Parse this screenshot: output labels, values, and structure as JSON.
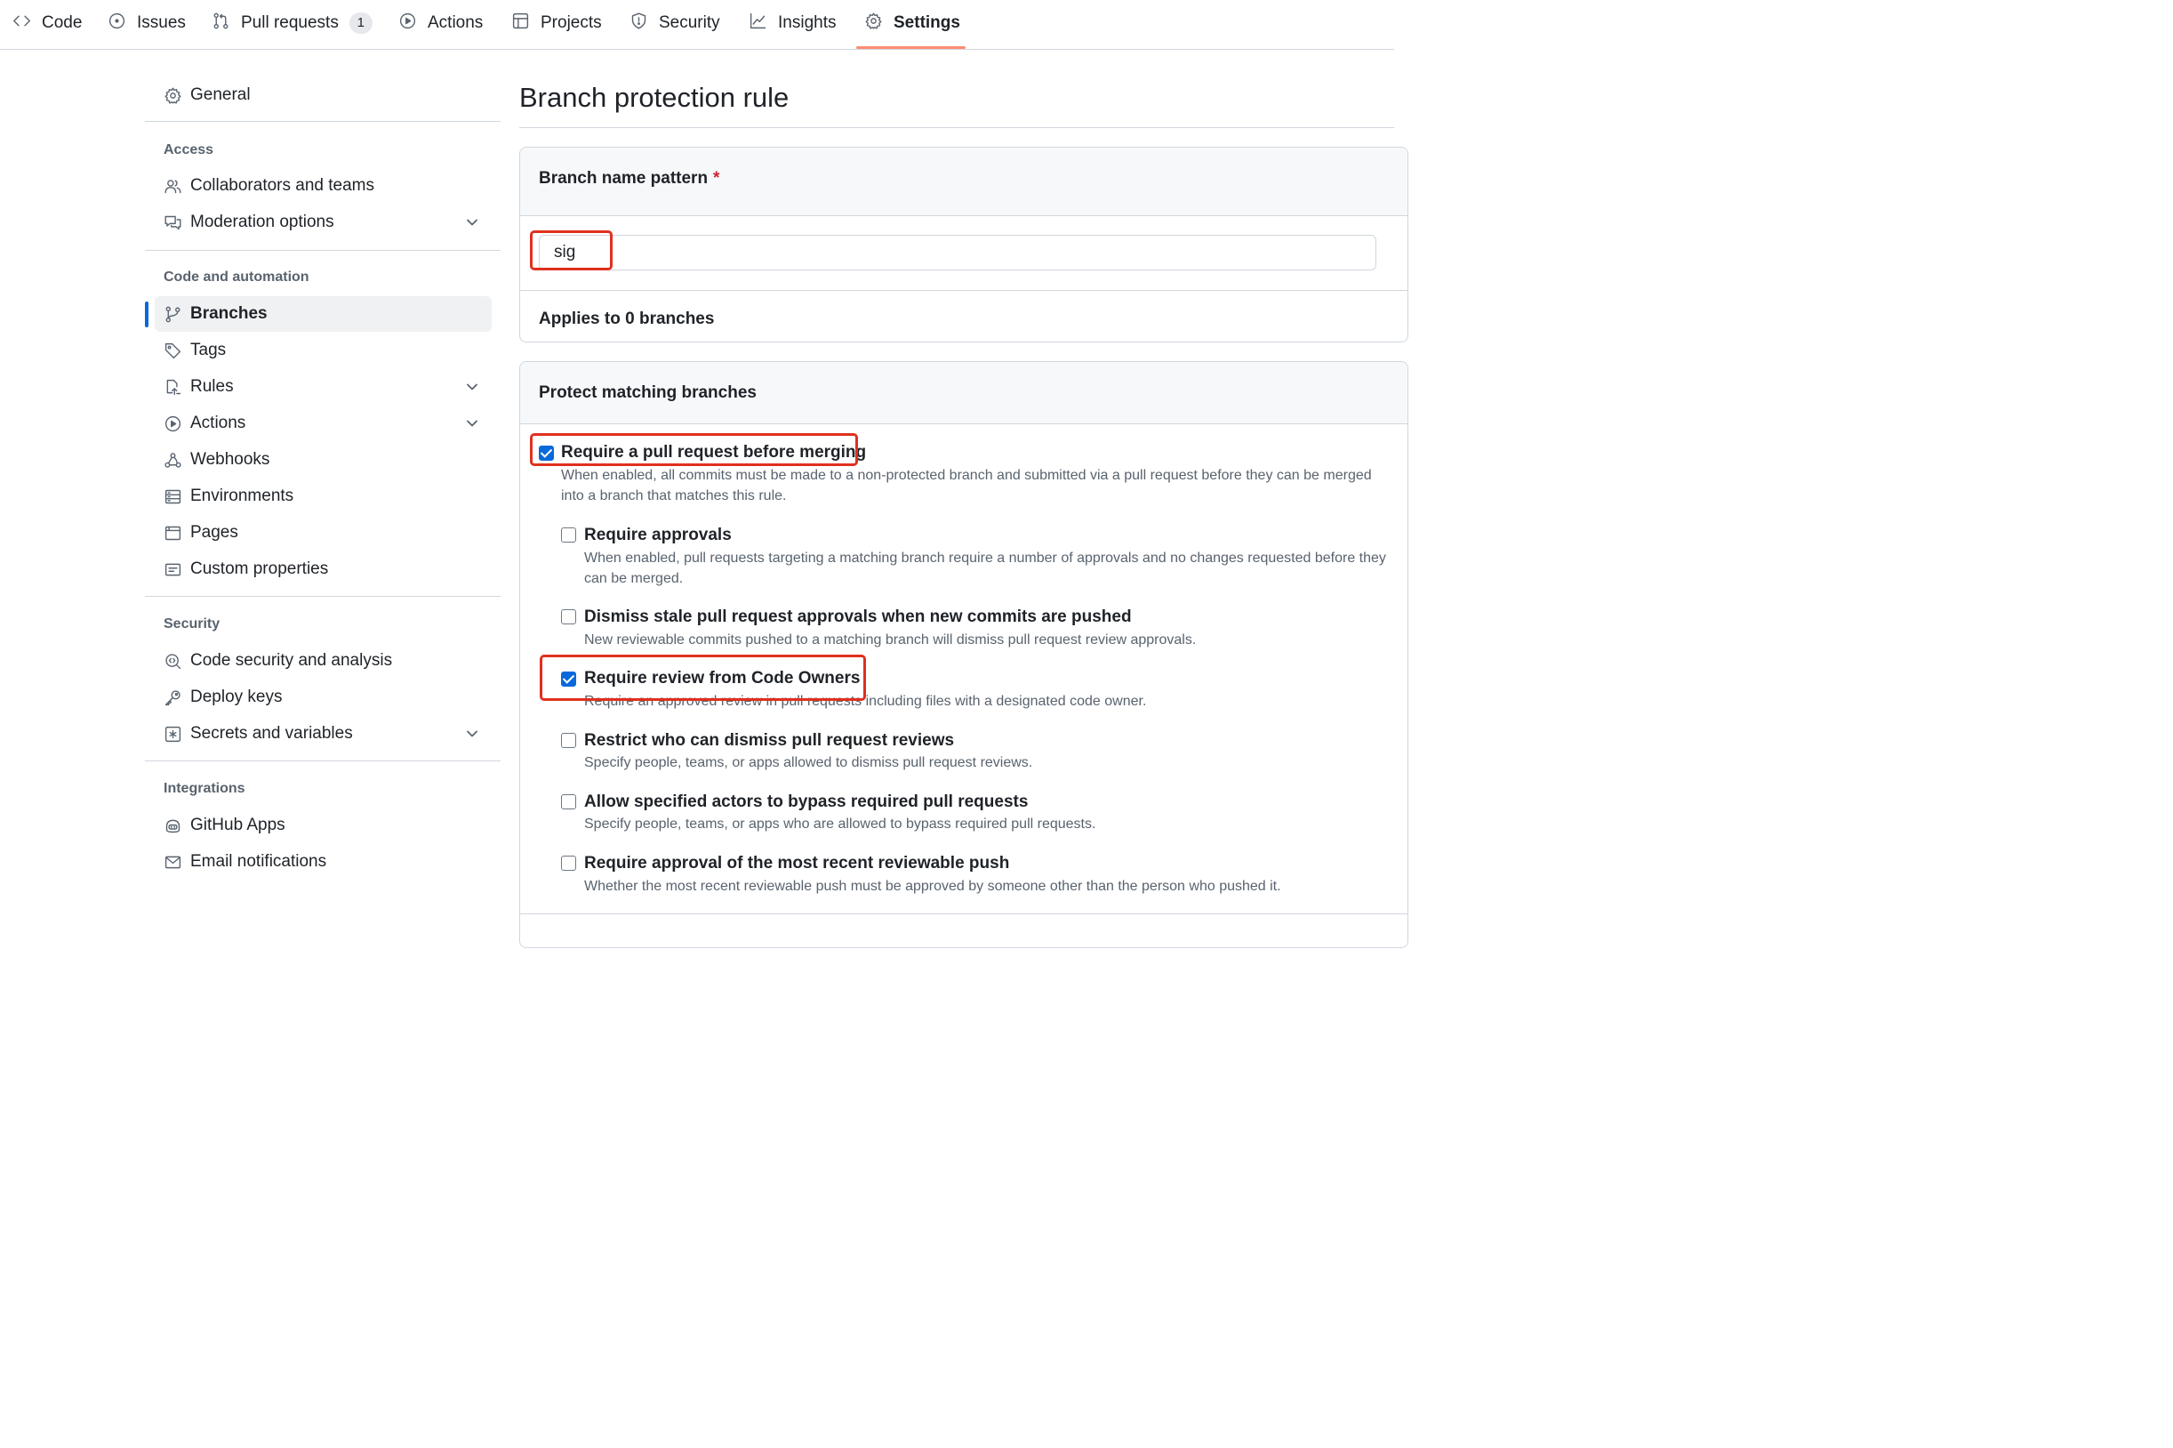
{
  "nav": {
    "tabs": [
      {
        "label": "Code",
        "icon": "code-icon"
      },
      {
        "label": "Issues",
        "icon": "issue-icon"
      },
      {
        "label": "Pull requests",
        "icon": "pull-request-icon",
        "count": "1"
      },
      {
        "label": "Actions",
        "icon": "play-icon"
      },
      {
        "label": "Projects",
        "icon": "table-icon"
      },
      {
        "label": "Security",
        "icon": "shield-icon"
      },
      {
        "label": "Insights",
        "icon": "graph-icon"
      },
      {
        "label": "Settings",
        "icon": "gear-icon",
        "active": true
      }
    ]
  },
  "sidebar": {
    "general": "General",
    "sections": {
      "access": {
        "heading": "Access",
        "items": [
          "Collaborators and teams",
          "Moderation options"
        ]
      },
      "code": {
        "heading": "Code and automation",
        "items": [
          "Branches",
          "Tags",
          "Rules",
          "Actions",
          "Webhooks",
          "Environments",
          "Pages",
          "Custom properties"
        ]
      },
      "security": {
        "heading": "Security",
        "items": [
          "Code security and analysis",
          "Deploy keys",
          "Secrets and variables"
        ]
      },
      "integrations": {
        "heading": "Integrations",
        "items": [
          "GitHub Apps",
          "Email notifications"
        ]
      }
    },
    "selected": "Branches"
  },
  "main": {
    "title": "Branch protection rule",
    "pattern": {
      "label": "Branch name pattern",
      "required_mark": "*",
      "value": "sig",
      "applies": "Applies to 0 branches"
    },
    "protect": {
      "heading": "Protect matching branches",
      "options": [
        {
          "label": "Require a pull request before merging",
          "checked": true,
          "desc": "When enabled, all commits must be made to a non-protected branch and submitted via a pull request before they can be merged into a branch that matches this rule."
        },
        {
          "label": "Require approvals",
          "checked": false,
          "desc": "When enabled, pull requests targeting a matching branch require a number of approvals and no changes requested before they can be merged."
        },
        {
          "label": "Dismiss stale pull request approvals when new commits are pushed",
          "checked": false,
          "desc": "New reviewable commits pushed to a matching branch will dismiss pull request review approvals."
        },
        {
          "label": "Require review from Code Owners",
          "checked": true,
          "desc": "Require an approved review in pull requests including files with a designated code owner."
        },
        {
          "label": "Restrict who can dismiss pull request reviews",
          "checked": false,
          "desc": "Specify people, teams, or apps allowed to dismiss pull request reviews."
        },
        {
          "label": "Allow specified actors to bypass required pull requests",
          "checked": false,
          "desc": "Specify people, teams, or apps who are allowed to bypass required pull requests."
        },
        {
          "label": "Require approval of the most recent reviewable push",
          "checked": false,
          "desc": "Whether the most recent reviewable push must be approved by someone other than the person who pushed it."
        }
      ]
    }
  },
  "colors": {
    "accent": "#0969da",
    "highlight": "#e0301e",
    "tab_underline": "#fd8c73"
  }
}
